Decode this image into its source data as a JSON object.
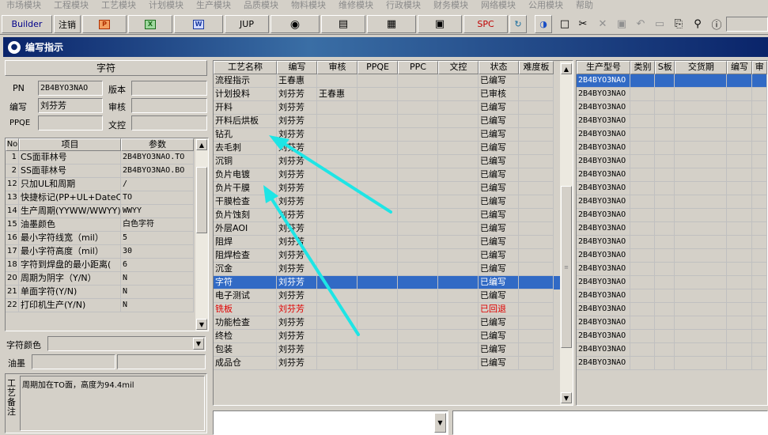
{
  "menu": [
    "市场模块",
    "工程模块",
    "工艺模块",
    "计划模块",
    "生产模块",
    "品质模块",
    "物料模块",
    "维修模块",
    "行政模块",
    "财务模块",
    "网络模块",
    "公用模块",
    "帮助"
  ],
  "toolbar": {
    "builder_label": "Builder",
    "logout_label": "注销",
    "jup_label": "JUP",
    "spc_label": "SPC"
  },
  "window": {
    "title": "编写指示"
  },
  "left": {
    "section_title": "字符",
    "pn_label": "PN",
    "pn_value": "2B4BYO3NAO",
    "version_label": "版本",
    "version_value": "",
    "author_label": "编写",
    "author_value": "刘芬芳",
    "reviewer_label": "审核",
    "reviewer_value": "",
    "ppqe_label": "PPQE",
    "ppqe_value": "",
    "doc_control_label": "文控",
    "doc_control_value": "",
    "param_headers": [
      "No",
      "项目",
      "参数"
    ],
    "params": [
      {
        "no": "1",
        "item": "CS面菲林号",
        "value": "2B4BYO3NAO.TO"
      },
      {
        "no": "2",
        "item": "SS面菲林号",
        "value": "2B4BYO3NAO.BO"
      },
      {
        "no": "12",
        "item": "只加UL和周期",
        "value": "/"
      },
      {
        "no": "13",
        "item": "快捷标记(PP+UL+DateCo",
        "value": "TO"
      },
      {
        "no": "14",
        "item": "生产周期(YYWW/WWYY)",
        "value": "WWYY"
      },
      {
        "no": "15",
        "item": "油墨颜色",
        "value": "白色字符"
      },
      {
        "no": "16",
        "item": "最小字符线宽（mil）",
        "value": "5"
      },
      {
        "no": "17",
        "item": "最小字符高度（mil）",
        "value": "30"
      },
      {
        "no": "18",
        "item": "字符到焊盘的最小距离(",
        "value": "6"
      },
      {
        "no": "20",
        "item": "周期为阴字（Y/N）",
        "value": "N"
      },
      {
        "no": "21",
        "item": "单面字符(Y/N)",
        "value": "N"
      },
      {
        "no": "22",
        "item": "打印机生产(Y/N)",
        "value": "N"
      }
    ],
    "char_color_label": "字符颜色",
    "char_color_value": "",
    "ink_label": "油墨",
    "ink_value": "",
    "remarks_label": "工艺备注",
    "remarks_text": "周期加在TO面，高度为94.4mil"
  },
  "process_table": {
    "headers": [
      "工艺名称",
      "编写",
      "审核",
      "PPQE",
      "PPC",
      "文控",
      "状态",
      "难度板"
    ],
    "rows": [
      {
        "name": "流程指示",
        "author": "王春惠",
        "reviewer": "",
        "ppqe": "",
        "ppc": "",
        "doc": "",
        "status": "已编写",
        "diff": ""
      },
      {
        "name": "计划投料",
        "author": "刘芬芳",
        "reviewer": "王春惠",
        "ppqe": "",
        "ppc": "",
        "doc": "",
        "status": "已审核",
        "diff": ""
      },
      {
        "name": "开料",
        "author": "刘芬芳",
        "reviewer": "",
        "ppqe": "",
        "ppc": "",
        "doc": "",
        "status": "已编写",
        "diff": ""
      },
      {
        "name": "开料后烘板",
        "author": "刘芬芳",
        "reviewer": "",
        "ppqe": "",
        "ppc": "",
        "doc": "",
        "status": "已编写",
        "diff": ""
      },
      {
        "name": "钻孔",
        "author": "刘芬芳",
        "reviewer": "",
        "ppqe": "",
        "ppc": "",
        "doc": "",
        "status": "已编写",
        "diff": ""
      },
      {
        "name": "去毛刺",
        "author": "刘芬芳",
        "reviewer": "",
        "ppqe": "",
        "ppc": "",
        "doc": "",
        "status": "已编写",
        "diff": ""
      },
      {
        "name": "沉铜",
        "author": "刘芬芳",
        "reviewer": "",
        "ppqe": "",
        "ppc": "",
        "doc": "",
        "status": "已编写",
        "diff": ""
      },
      {
        "name": "负片电镀",
        "author": "刘芬芳",
        "reviewer": "",
        "ppqe": "",
        "ppc": "",
        "doc": "",
        "status": "已编写",
        "diff": ""
      },
      {
        "name": "负片干膜",
        "author": "刘芬芳",
        "reviewer": "",
        "ppqe": "",
        "ppc": "",
        "doc": "",
        "status": "已编写",
        "diff": ""
      },
      {
        "name": "干膜检查",
        "author": "刘芬芳",
        "reviewer": "",
        "ppqe": "",
        "ppc": "",
        "doc": "",
        "status": "已编写",
        "diff": ""
      },
      {
        "name": "负片蚀刻",
        "author": "刘芬芳",
        "reviewer": "",
        "ppqe": "",
        "ppc": "",
        "doc": "",
        "status": "已编写",
        "diff": ""
      },
      {
        "name": "外层AOI",
        "author": "刘芬芳",
        "reviewer": "",
        "ppqe": "",
        "ppc": "",
        "doc": "",
        "status": "已编写",
        "diff": ""
      },
      {
        "name": "阻焊",
        "author": "刘芬芳",
        "reviewer": "",
        "ppqe": "",
        "ppc": "",
        "doc": "",
        "status": "已编写",
        "diff": ""
      },
      {
        "name": "阻焊检查",
        "author": "刘芬芳",
        "reviewer": "",
        "ppqe": "",
        "ppc": "",
        "doc": "",
        "status": "已编写",
        "diff": ""
      },
      {
        "name": "沉金",
        "author": "刘芬芳",
        "reviewer": "",
        "ppqe": "",
        "ppc": "",
        "doc": "",
        "status": "已编写",
        "diff": ""
      },
      {
        "name": "字符",
        "author": "刘芬芳",
        "reviewer": "",
        "ppqe": "",
        "ppc": "",
        "doc": "",
        "status": "已编写",
        "diff": ""
      },
      {
        "name": "电子测试",
        "author": "刘芬芳",
        "reviewer": "",
        "ppqe": "",
        "ppc": "",
        "doc": "",
        "status": "已编写",
        "diff": ""
      },
      {
        "name": "铣板",
        "author": "刘芬芳",
        "reviewer": "",
        "ppqe": "",
        "ppc": "",
        "doc": "",
        "status": "已回退",
        "diff": ""
      },
      {
        "name": "功能检查",
        "author": "刘芬芳",
        "reviewer": "",
        "ppqe": "",
        "ppc": "",
        "doc": "",
        "status": "已编写",
        "diff": ""
      },
      {
        "name": "终检",
        "author": "刘芬芳",
        "reviewer": "",
        "ppqe": "",
        "ppc": "",
        "doc": "",
        "status": "已编写",
        "diff": ""
      },
      {
        "name": "包装",
        "author": "刘芬芳",
        "reviewer": "",
        "ppqe": "",
        "ppc": "",
        "doc": "",
        "status": "已编写",
        "diff": ""
      },
      {
        "name": "成品仓",
        "author": "刘芬芳",
        "reviewer": "",
        "ppqe": "",
        "ppc": "",
        "doc": "",
        "status": "已编写",
        "diff": ""
      }
    ],
    "selected_row": 15,
    "rejected_row": 17
  },
  "model_table": {
    "headers": [
      "生产型号",
      "类别",
      "S板",
      "交货期",
      "编写",
      "审"
    ],
    "rows": [
      "2B4BYO3NAO",
      "2B4BYO3NAO",
      "2B4BYO3NAO",
      "2B4BYO3NAO",
      "2B4BYO3NAO",
      "2B4BYO3NAO",
      "2B4BYO3NAO",
      "2B4BYO3NAO",
      "2B4BYO3NAO",
      "2B4BYO3NAO",
      "2B4BYO3NAO",
      "2B4BYO3NAO",
      "2B4BYO3NAO",
      "2B4BYO3NAO",
      "2B4BYO3NAO",
      "2B4BYO3NAO",
      "2B4BYO3NAO",
      "2B4BYO3NAO",
      "2B4BYO3NAO",
      "2B4BYO3NAO",
      "2B4BYO3NAO",
      "2B4BYO3NAO"
    ]
  },
  "colors": {
    "selection": "#316ac5",
    "title_bar": "#0a246a",
    "annotation_arrow": "#1ee5e5",
    "rejected_text": "#e00000"
  }
}
